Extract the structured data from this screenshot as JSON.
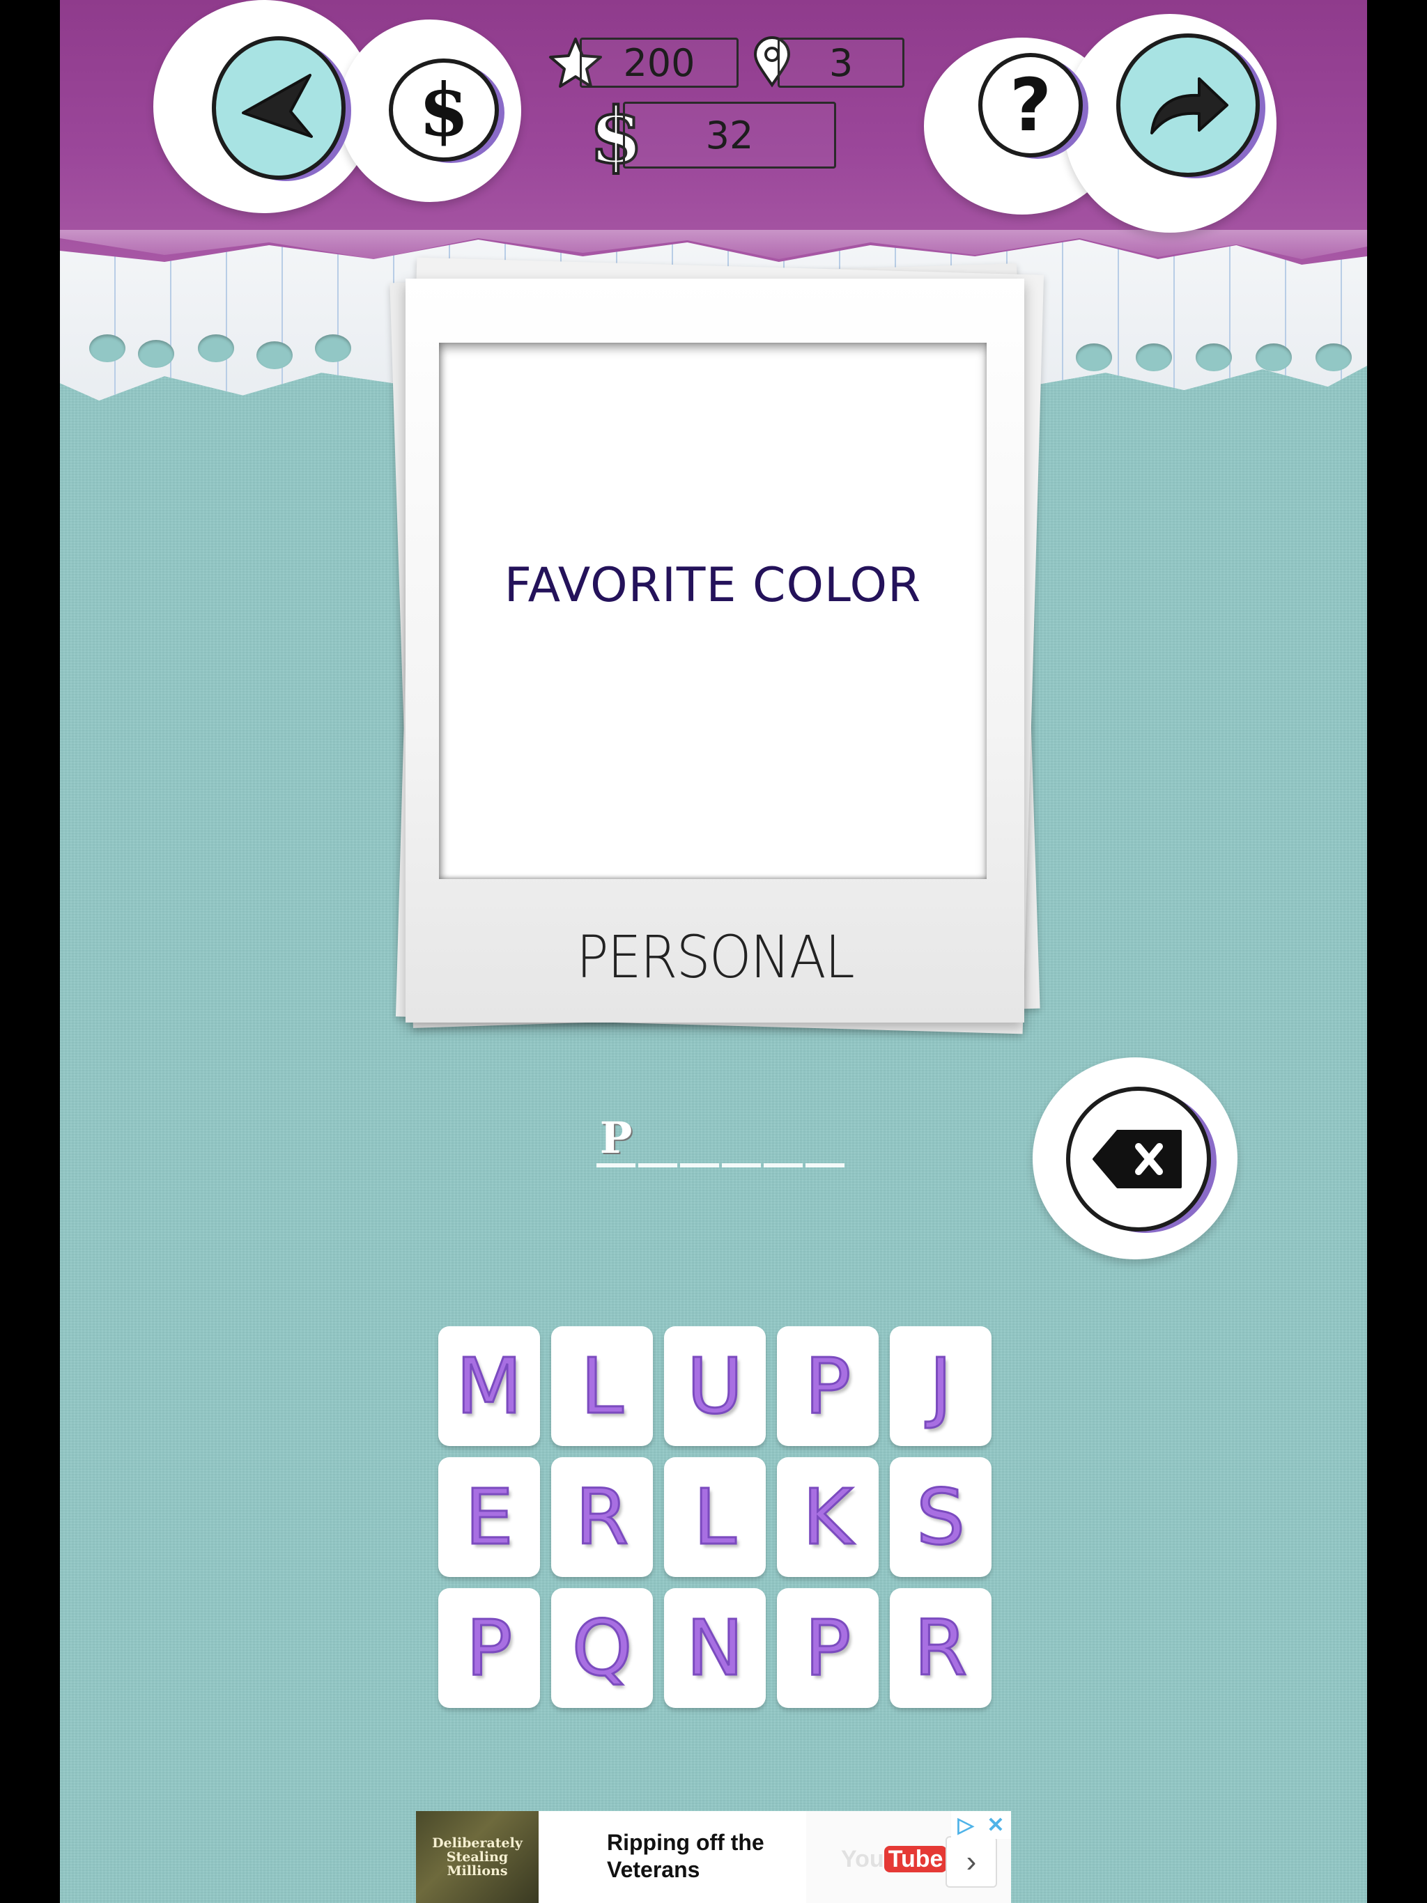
{
  "header": {
    "stars": "200",
    "level": "3",
    "coins": "32",
    "buttons": {
      "back": "back",
      "shop": "$",
      "help": "?",
      "share": "share"
    }
  },
  "puzzle": {
    "clue": "FAVORITE COLOR",
    "category": "PERSONAL",
    "answer_letters": [
      "P",
      "",
      "",
      "",
      "",
      ""
    ]
  },
  "tiles": [
    [
      "M",
      "L",
      "U",
      "P",
      "J"
    ],
    [
      "E",
      "R",
      "L",
      "K",
      "S"
    ],
    [
      "P",
      "Q",
      "N",
      "P",
      "R"
    ]
  ],
  "ad": {
    "image_text": [
      "Deliberately",
      "Stealing",
      "Millions"
    ],
    "headline": "Ripping off the Veterans",
    "brand_you": "You",
    "brand_tube": "Tube",
    "arrow": "›",
    "adchoices": "▷",
    "close": "✕"
  },
  "colors": {
    "header": "#9b479a",
    "background": "#92c7c5",
    "tile_letter": "#a86fe2",
    "clue_text": "#24125a"
  },
  "icons": {
    "back": "back-arrow-icon",
    "shop": "dollar-icon",
    "help": "question-icon",
    "share": "share-arrow-icon",
    "delete": "backspace-icon",
    "star": "star-icon",
    "level": "map-pin-icon",
    "coins": "dollar-icon"
  }
}
